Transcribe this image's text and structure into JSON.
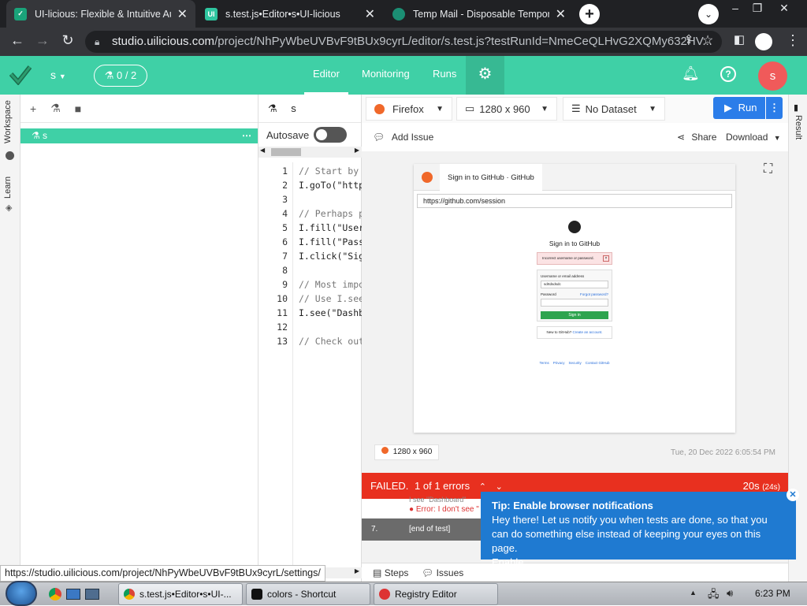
{
  "browser": {
    "tabs": [
      {
        "title": "UI-licious: Flexible & Intuitive Aut",
        "active": true,
        "icon": "uilicious-favicon"
      },
      {
        "title": "s.test.js•Editor•s•UI-licious",
        "active": false,
        "icon": "uilicious-ui-favicon"
      },
      {
        "title": "Temp Mail - Disposable Tempora",
        "active": false,
        "icon": "tempmail-favicon"
      }
    ],
    "url_host": "studio.uilicious.com",
    "url_path": "/project/NhPyWbeUVBvF9tBUx9cyrL/editor/s.test.js?testRunId=NmeCeQLHvG2XQMy632HV..."
  },
  "app": {
    "project_selector": "s",
    "test_counter": "0 / 2",
    "nav": {
      "editor": "Editor",
      "monitoring": "Monitoring",
      "runs": "Runs"
    },
    "avatar_letter": "s",
    "sidebar_labels": {
      "workspace": "Workspace",
      "learn": "Learn"
    },
    "file_item": "s",
    "editor_tab": "s",
    "autosave_label": "Autosave",
    "code_lines": [
      {
        "n": "1",
        "text": "// Start by",
        "comment": true
      },
      {
        "n": "2",
        "text": "I.goTo(\"http",
        "comment": false
      },
      {
        "n": "3",
        "text": "",
        "comment": false
      },
      {
        "n": "4",
        "text": "// Perhaps p",
        "comment": true
      },
      {
        "n": "5",
        "text": "I.fill(\"User",
        "comment": false
      },
      {
        "n": "6",
        "text": "I.fill(\"Pass",
        "comment": false
      },
      {
        "n": "7",
        "text": "I.click(\"Sig",
        "comment": false
      },
      {
        "n": "8",
        "text": "",
        "comment": false
      },
      {
        "n": "9",
        "text": "// Most impo",
        "comment": true
      },
      {
        "n": "10",
        "text": "// Use I.see",
        "comment": true
      },
      {
        "n": "11",
        "text": "I.see(\"Dashb",
        "comment": false
      },
      {
        "n": "12",
        "text": "",
        "comment": false
      },
      {
        "n": "13",
        "text": "// Check out",
        "comment": true
      }
    ],
    "toolbar": {
      "browser": "Firefox",
      "resolution": "1280 x 960",
      "dataset": "No Dataset",
      "run": "Run"
    },
    "actions": {
      "add_issue": "Add Issue",
      "share": "Share",
      "download": "Download"
    },
    "preview": {
      "tab_title": "Sign in to GitHub · GitHub",
      "url": "https://github.com/session",
      "heading": "Sign in to GitHub",
      "error": "Incorrect username or password.",
      "username_label": "Username or email address",
      "username_value": "sdrtdsdsdc",
      "password_label": "Password",
      "forgot": "Forgot password?",
      "signin": "Sign in",
      "new_prompt": "New to GitHub?",
      "create_link": "Create an account.",
      "footer": [
        "Terms",
        "Privacy",
        "Security",
        "Contact GitHub"
      ]
    },
    "result_badge": "1280 x 960",
    "timestamp": "Tue, 20 Dec 2022 6:05:54 PM",
    "failbar": {
      "status": "FAILED.",
      "errors": "1 of 1 errors",
      "duration": "20s",
      "duration_total": "(24s)"
    },
    "steps": {
      "step_text": "I see \"Dashboard\"",
      "error_text": "Error: I don't see \"",
      "end_num": "7.",
      "end_text": "[end of test]"
    },
    "bottom_tabs": {
      "steps": "Steps",
      "issues": "Issues"
    },
    "result_strip_label": "Result"
  },
  "tip": {
    "title": "Tip: Enable browser notifications",
    "body": "Hey there! Let us notify you when tests are done, so that you can do something else instead of keeping your eyes on this page.",
    "link": "Enable"
  },
  "status_link": "https://studio.uilicious.com/project/NhPyWbeUVBvF9tBUx9cyrL/settings/",
  "taskbar": {
    "items": [
      "s.test.js•Editor•s•UI-...",
      "colors - Shortcut",
      "Registry Editor"
    ],
    "clock": "6:23 PM"
  },
  "colors": {
    "brand": "#3fd0a6",
    "run": "#2b7de9",
    "fail": "#e8301f",
    "tip": "#1f7ad1"
  }
}
